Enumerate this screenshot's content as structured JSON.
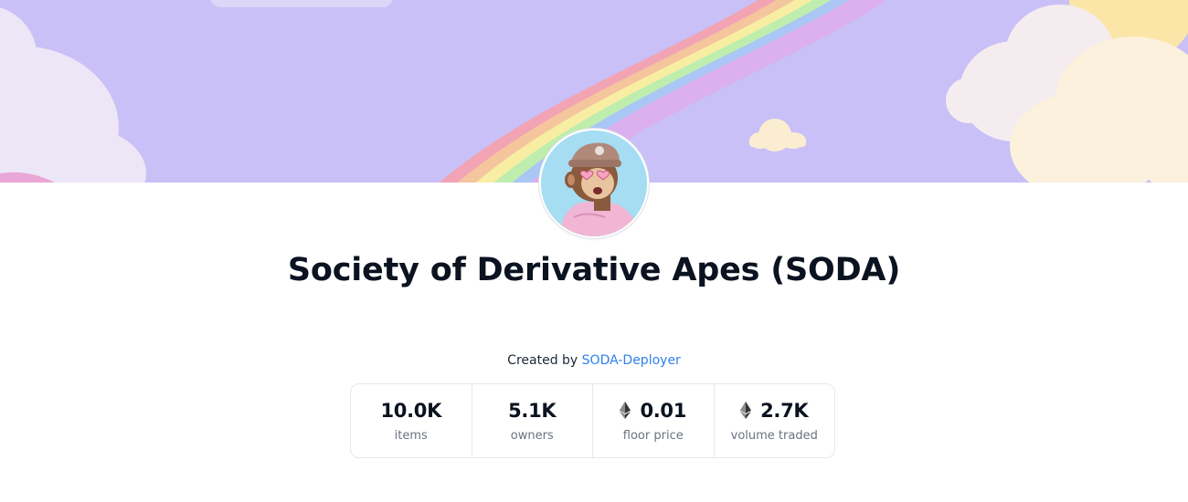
{
  "collection": {
    "title": "Society of Derivative Apes (SODA)",
    "created_by_prefix": "Created by ",
    "creator_name": "SODA-Deployer"
  },
  "banner": {
    "description_icon": "rainbow-clouds-banner",
    "sky_color": "#c9c0f7"
  },
  "avatar": {
    "icon": "ape-avatar-icon"
  },
  "stats": [
    {
      "value": "10.0K",
      "label": "items",
      "currency_icon": ""
    },
    {
      "value": "5.1K",
      "label": "owners",
      "currency_icon": ""
    },
    {
      "value": "0.01",
      "label": "floor price",
      "currency_icon": "ethereum-icon"
    },
    {
      "value": "2.7K",
      "label": "volume traded",
      "currency_icon": "ethereum-icon"
    }
  ],
  "colors": {
    "link": "#2f80ed",
    "title": "#0b1220",
    "muted": "#6b7280"
  }
}
